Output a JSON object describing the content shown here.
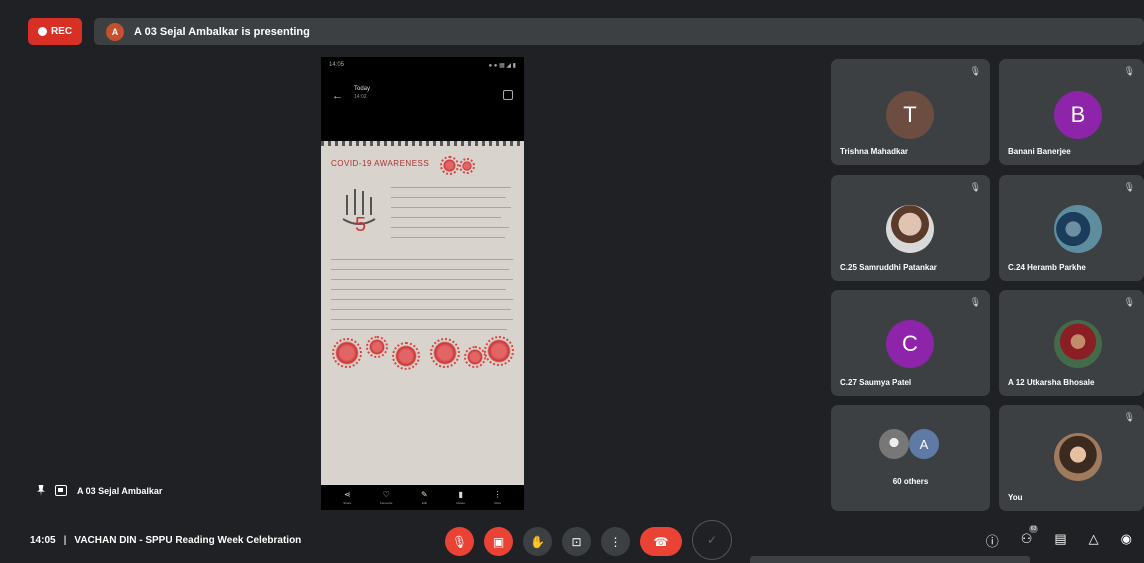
{
  "topbar": {
    "rec_label": "REC",
    "presenter_initial": "A",
    "presenting_text": "A 03 Sejal Ambalkar is presenting"
  },
  "stage": {
    "phone_status_left": "14:05",
    "phone_status_right": "● ● ▦ ◢ ▮",
    "phone_title": "Today",
    "phone_subtitle": "14:02",
    "paper_title": "COVID-19 AWARENESS",
    "bottom_actions": [
      {
        "icon": "share",
        "label": "Share"
      },
      {
        "icon": "heart",
        "label": "Favourite"
      },
      {
        "icon": "edit",
        "label": "Edit"
      },
      {
        "icon": "trash",
        "label": "Delete"
      },
      {
        "icon": "more",
        "label": "More"
      }
    ]
  },
  "participants": [
    {
      "name": "Trishna Mahadkar",
      "initial": "T",
      "color": "#6d4c41"
    },
    {
      "name": "Banani Banerjee",
      "initial": "B",
      "color": "#8e24aa"
    },
    {
      "name": "C.25 Samruddhi Patankar",
      "initial": ""
    },
    {
      "name": "C.24 Heramb Parkhe",
      "initial": ""
    },
    {
      "name": "C.27 Saumya Patel",
      "initial": "C",
      "color": "#8e24aa"
    },
    {
      "name": "A 12 Utkarsha Bhosale",
      "initial": ""
    },
    {
      "name": "60 others",
      "initial": "A"
    },
    {
      "name": "You",
      "initial": ""
    }
  ],
  "presenter_label": "A 03 Sejal Ambalkar",
  "meeting": {
    "time": "14:05",
    "title": "VACHAN DIN - SPPU Reading Week Celebration"
  },
  "participants_badge": "63"
}
